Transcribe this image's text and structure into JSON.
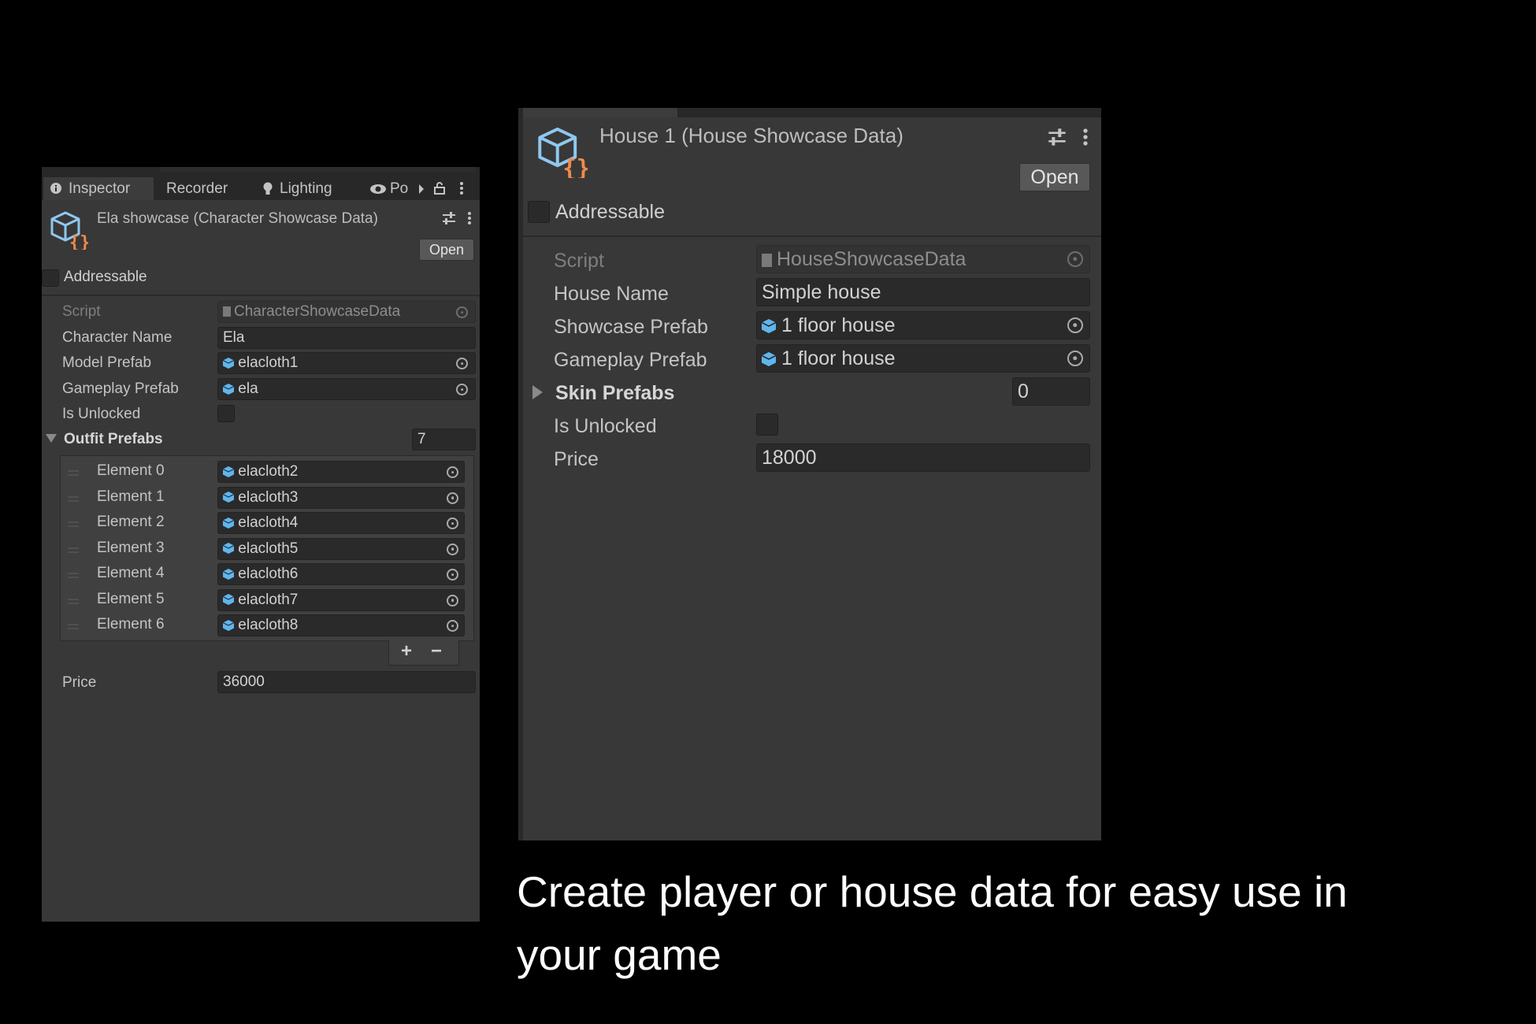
{
  "left_panel": {
    "tabs": [
      "Inspector",
      "Recorder",
      "Lighting",
      "Po"
    ],
    "title": "Ela showcase (Character Showcase Data)",
    "open_label": "Open",
    "addressable_label": "Addressable",
    "script_label": "Script",
    "script_value": "CharacterShowcaseData",
    "character_name_label": "Character Name",
    "character_name_value": "Ela",
    "model_prefab_label": "Model Prefab",
    "model_prefab_value": "elacloth1",
    "gameplay_prefab_label": "Gameplay Prefab",
    "gameplay_prefab_value": "ela",
    "is_unlocked_label": "Is Unlocked",
    "outfit_prefabs_label": "Outfit Prefabs",
    "outfit_prefabs_count": "7",
    "elements": [
      {
        "label": "Element 0",
        "value": "elacloth2"
      },
      {
        "label": "Element 1",
        "value": "elacloth3"
      },
      {
        "label": "Element 2",
        "value": "elacloth4"
      },
      {
        "label": "Element 3",
        "value": "elacloth5"
      },
      {
        "label": "Element 4",
        "value": "elacloth6"
      },
      {
        "label": "Element 5",
        "value": "elacloth7"
      },
      {
        "label": "Element 6",
        "value": "elacloth8"
      }
    ],
    "add_label": "+",
    "remove_label": "−",
    "price_label": "Price",
    "price_value": "36000"
  },
  "right_panel": {
    "title": "House 1 (House Showcase Data)",
    "open_label": "Open",
    "addressable_label": "Addressable",
    "script_label": "Script",
    "script_value": "HouseShowcaseData",
    "house_name_label": "House Name",
    "house_name_value": "Simple house",
    "showcase_prefab_label": "Showcase Prefab",
    "showcase_prefab_value": "1 floor house",
    "gameplay_prefab_label": "Gameplay Prefab",
    "gameplay_prefab_value": "1 floor house",
    "skin_prefabs_label": "Skin Prefabs",
    "skin_prefabs_count": "0",
    "is_unlocked_label": "Is Unlocked",
    "price_label": "Price",
    "price_value": "18000"
  },
  "caption": {
    "line1": "Create player or house data for  easy use in",
    "line2": "your game"
  },
  "colors": {
    "background": "#000000",
    "panel": "#383838",
    "field": "#2a2a2a",
    "prefab_icon": "#5fb5ee",
    "script_asset_icon": "#f08a4b"
  },
  "icons": [
    "info-icon",
    "lightbulb-icon",
    "eye-icon",
    "lock-icon",
    "menu-dots-icon",
    "preset-sliders-icon",
    "scriptable-object-icon",
    "prefab-cube-icon",
    "object-picker-icon",
    "foldout-arrow-icon",
    "drag-handle-icon"
  ]
}
